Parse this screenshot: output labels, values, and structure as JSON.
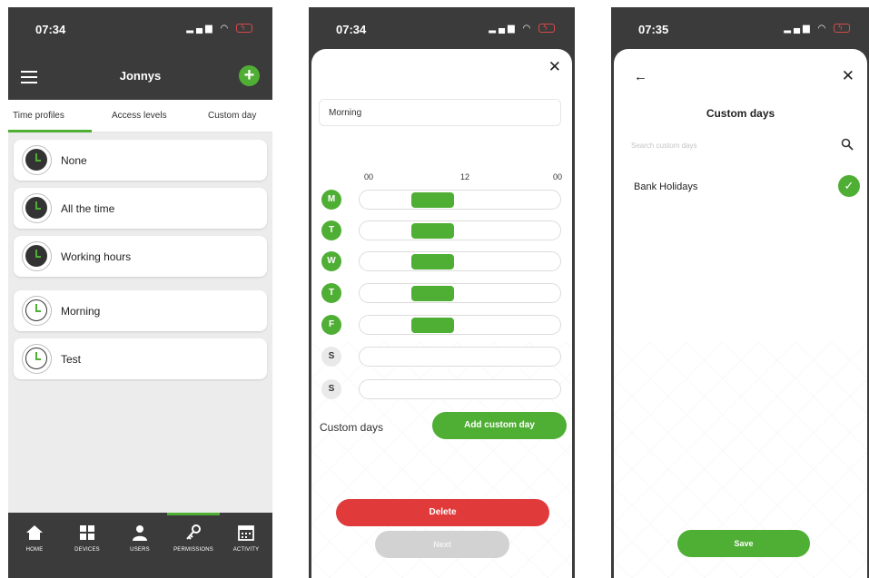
{
  "colors": {
    "accent": "#4fae34",
    "danger": "#e13a3a",
    "dark": "#3b3b3b"
  },
  "screen1": {
    "time": "07:34",
    "title": "Jonnys",
    "tabs": [
      "Time profiles",
      "Access levels",
      "Custom day"
    ],
    "profiles": [
      {
        "label": "None",
        "icon": "clock-filled-icon"
      },
      {
        "label": "All the time",
        "icon": "clock-filled-icon"
      },
      {
        "label": "Working hours",
        "icon": "clock-filled-icon"
      },
      {
        "label": "Morning",
        "icon": "clock-outline-icon"
      },
      {
        "label": "Test",
        "icon": "clock-outline-icon"
      }
    ],
    "nav": [
      {
        "label": "HOME",
        "icon": "home-icon"
      },
      {
        "label": "DEVICES",
        "icon": "devices-icon"
      },
      {
        "label": "USERS",
        "icon": "user-icon"
      },
      {
        "label": "PERMISSIONS",
        "icon": "key-icon"
      },
      {
        "label": "ACTIVITY",
        "icon": "calendar-icon"
      }
    ],
    "selected_nav": "PERMISSIONS"
  },
  "screen2": {
    "time": "07:34",
    "name_value": "Morning",
    "hours": [
      "00",
      "12",
      "00"
    ],
    "days": [
      {
        "letter": "M",
        "active": true
      },
      {
        "letter": "T",
        "active": true
      },
      {
        "letter": "W",
        "active": true
      },
      {
        "letter": "T",
        "active": true
      },
      {
        "letter": "F",
        "active": true
      },
      {
        "letter": "S",
        "active": false
      },
      {
        "letter": "S",
        "active": false
      }
    ],
    "custom_days_label": "Custom days",
    "add_custom_day": "Add custom day",
    "delete": "Delete",
    "next": "Next"
  },
  "screen3": {
    "time": "07:35",
    "title": "Custom days",
    "search_placeholder": "Search custom days",
    "items": [
      {
        "label": "Bank Holidays",
        "selected": true
      }
    ],
    "save": "Save"
  }
}
